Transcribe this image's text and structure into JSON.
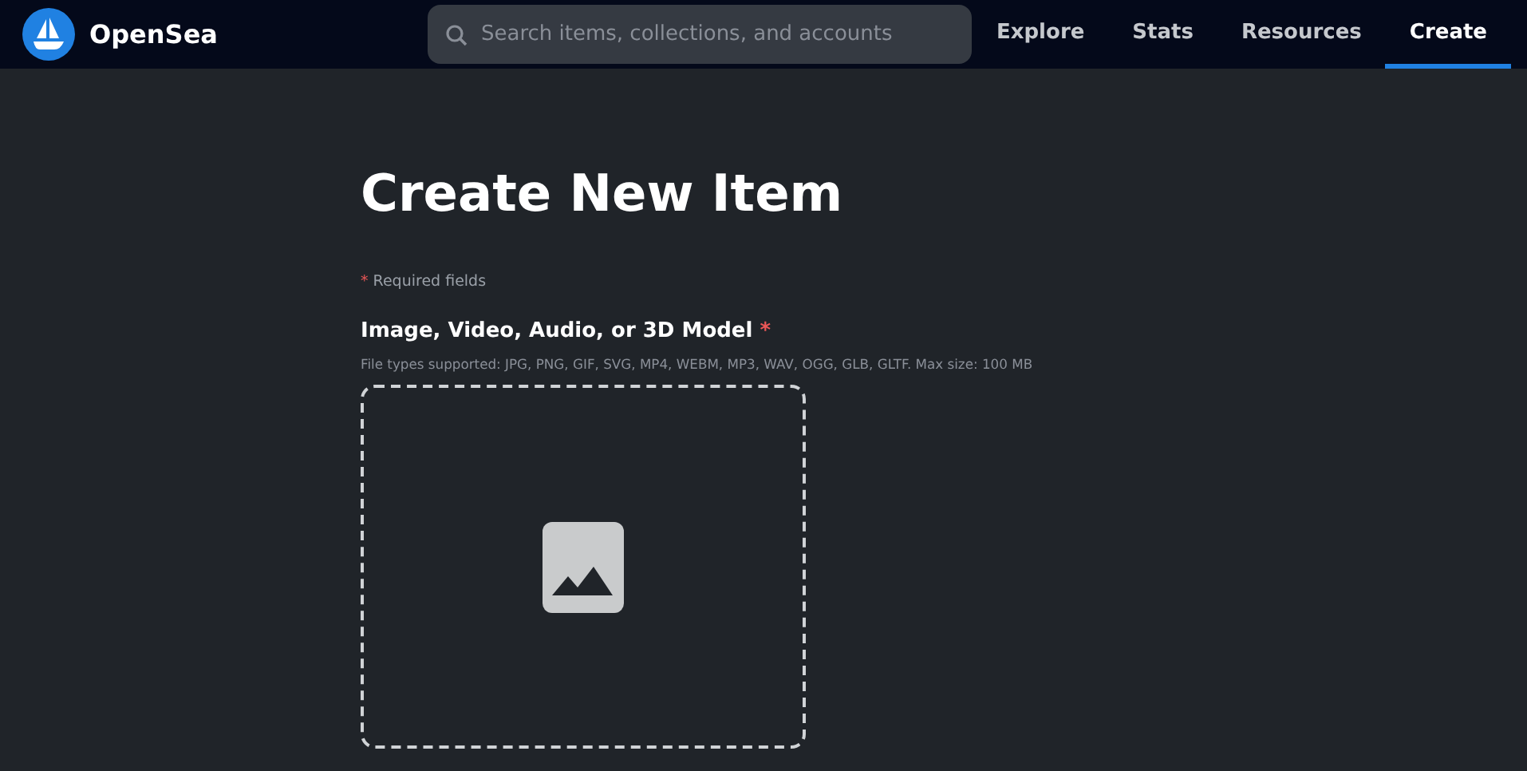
{
  "header": {
    "brand": "OpenSea",
    "search": {
      "placeholder": "Search items, collections, and accounts"
    },
    "nav": [
      {
        "label": "Explore",
        "selected": false
      },
      {
        "label": "Stats",
        "selected": false
      },
      {
        "label": "Resources",
        "selected": false
      },
      {
        "label": "Create",
        "selected": true
      }
    ]
  },
  "form": {
    "title": "Create New Item",
    "required_note": {
      "mark": "*",
      "text": "Required fields"
    },
    "media_field": {
      "label": "Image, Video, Audio, or 3D Model",
      "required_mark": "*",
      "hint": "File types supported: JPG, PNG, GIF, SVG, MP4, WEBM, MP3, WAV, OGG, GLB, GLTF. Max size: 100 MB"
    }
  }
}
